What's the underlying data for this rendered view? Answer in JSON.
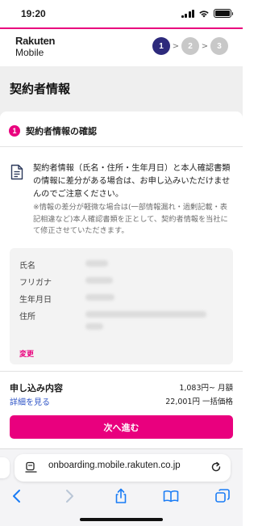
{
  "status_bar": {
    "time": "19:20"
  },
  "header": {
    "logo_line1": "Rakuten",
    "logo_line2": "Mobile",
    "steps": [
      "1",
      "2",
      "3"
    ],
    "step_separator": ">"
  },
  "page": {
    "title": "契約者情報"
  },
  "section": {
    "number": "1",
    "title": "契約者情報の確認"
  },
  "notice": {
    "main": "契約者情報（氏名・住所・生年月日）と本人確認書類の情報に差分がある場合は、お申し込みいただけませんのでご注意ください。",
    "sub": "※情報の差分が軽微な場合は(一部情報漏れ・過剰記載・表記相違など)本人確認書類を正として、契約者情報を当社にて修正させていただきます。"
  },
  "contract_info": {
    "labels": [
      "氏名",
      "フリガナ",
      "生年月日",
      "住所"
    ],
    "change_link": "変更"
  },
  "summary": {
    "title": "申し込み内容",
    "details_link": "詳細を見る",
    "monthly_price": "1,083円~ 月額",
    "one_time_price": "22,001円 一括価格",
    "next_button": "次へ進む"
  },
  "browser": {
    "url": "onboarding.mobile.rakuten.co.jp"
  },
  "colors": {
    "accent": "#e9007e",
    "step_active": "#2d2a7c",
    "step_inactive": "#c8c8c8",
    "link": "#2f55c7",
    "ios_blue": "#1a7cf5"
  }
}
